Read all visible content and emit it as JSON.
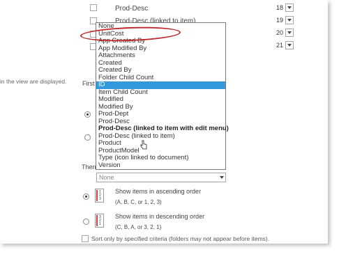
{
  "rows": [
    {
      "label": "Prod-Desc",
      "position": "18"
    },
    {
      "label": "Prod-Desc (linked to item)",
      "position": "19"
    },
    {
      "label": "",
      "position": "20"
    },
    {
      "label": "",
      "position": "21"
    }
  ],
  "left_note": "in the view are displayed.",
  "first_sort_label_fragment": "First s",
  "then_sort_label_fragment": "Then",
  "dropdown": {
    "options": [
      "None",
      "UnitCost",
      "App Created By",
      "App Modified By",
      "Attachments",
      "Created",
      "Created By",
      "Folder Child Count",
      "ID",
      "Item Child Count",
      "Modified",
      "Modified By",
      "Prod-Dept",
      "Prod-Desc",
      "Prod-Desc (linked to item with edit menu)",
      "Prod-Desc (linked to item)",
      "Product",
      "ProductModel",
      "Type (icon linked to document)",
      "Version"
    ],
    "selected": "ID",
    "hovered": "Prod-Desc (linked to item with edit menu)",
    "circled": "UnitCost"
  },
  "then_select": {
    "value": "None"
  },
  "sort_options": {
    "ascending": {
      "label": "Show items in ascending order",
      "hint": "(A, B, C, or 1, 2, 3)"
    },
    "descending": {
      "label": "Show items in descending order",
      "hint": "(C, B, A, or 3, 2, 1)"
    }
  },
  "sort_only_label": "Sort only by specified criteria (folders may not appear before items).",
  "colors": {
    "highlight": "#c0282a",
    "selected_bg": "#3399dd"
  }
}
